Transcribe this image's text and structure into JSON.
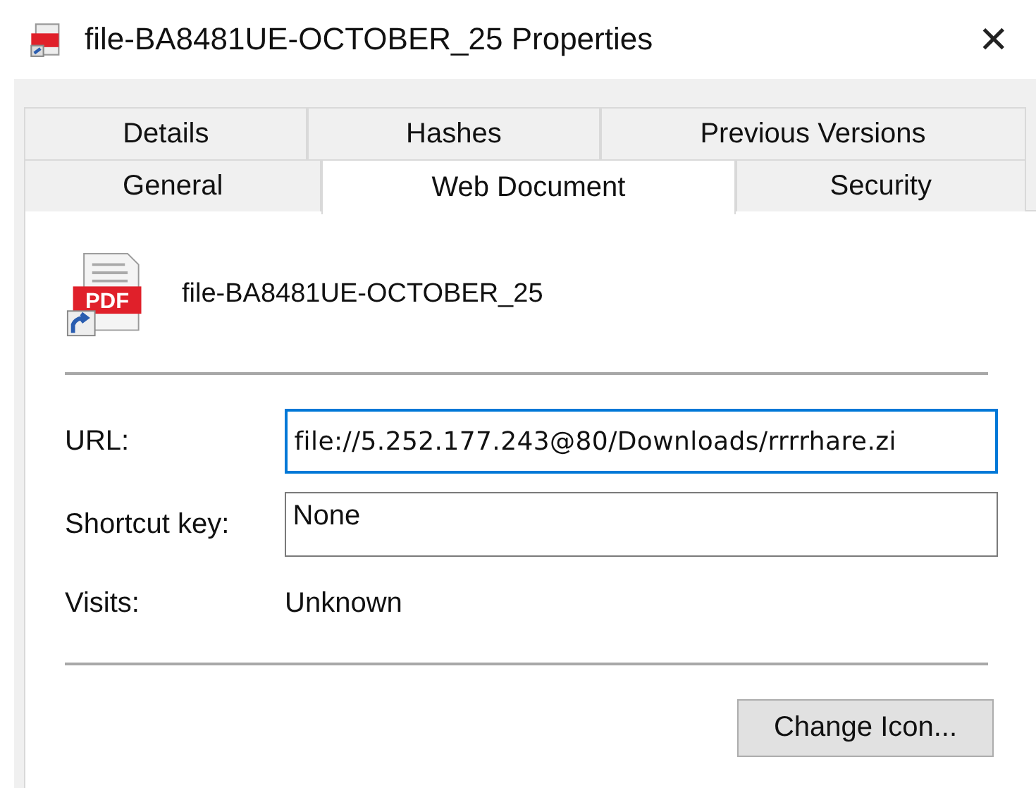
{
  "window": {
    "title": "file-BA8481UE-OCTOBER_25 Properties",
    "close": "✕"
  },
  "tab_rows": [
    [
      {
        "label": "Details",
        "selected": false
      },
      {
        "label": "Hashes",
        "selected": false
      },
      {
        "label": "Previous Versions",
        "selected": false
      }
    ],
    [
      {
        "label": "General",
        "selected": false
      },
      {
        "label": "Web Document",
        "selected": true
      },
      {
        "label": "Security",
        "selected": false
      }
    ]
  ],
  "file": {
    "name": "file-BA8481UE-OCTOBER_25",
    "icon_badge": "PDF"
  },
  "fields": [
    {
      "label": "URL:",
      "value": "file://5.252.177.243@80/Downloads/rrrrhare.zi",
      "focused": true
    },
    {
      "label": "Shortcut key:",
      "value": "None",
      "focused": false
    }
  ],
  "visits": {
    "label": "Visits:",
    "value": "Unknown"
  },
  "buttons": [
    "Change Icon..."
  ]
}
